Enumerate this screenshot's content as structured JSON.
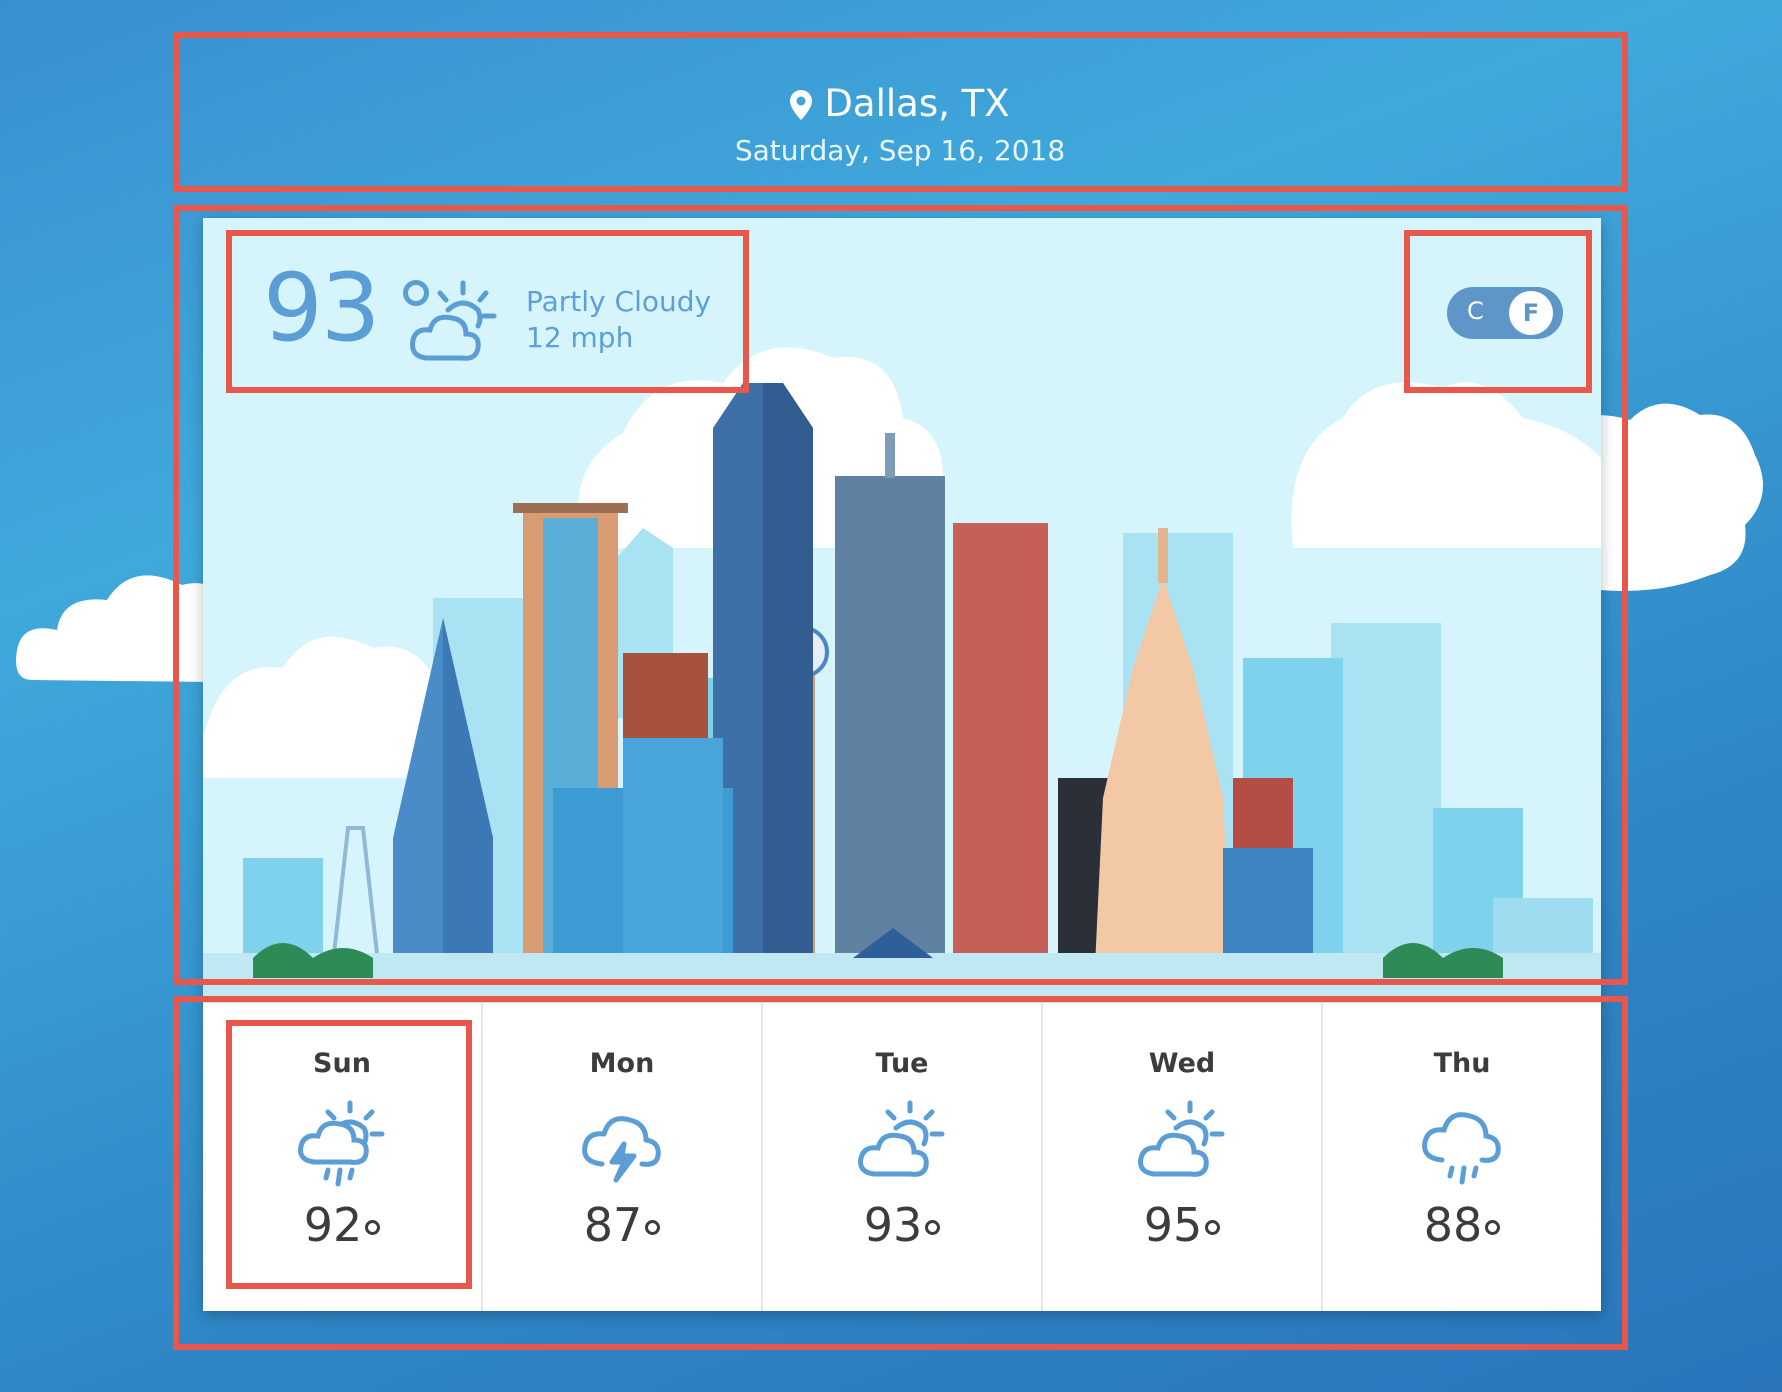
{
  "location": {
    "city": "Dallas, TX",
    "date": "Saturday, Sep 16, 2018"
  },
  "current": {
    "temperature": "93",
    "condition": "Partly Cloudy",
    "wind": "12 mph",
    "icon": "partly-cloudy-icon"
  },
  "units": {
    "celsius_label": "C",
    "fahrenheit_label": "F",
    "selected": "F"
  },
  "forecast": [
    {
      "day": "Sun",
      "temp": "92",
      "icon": "sun-cloud-rain-icon"
    },
    {
      "day": "Mon",
      "temp": "87",
      "icon": "thunderstorm-icon"
    },
    {
      "day": "Tue",
      "temp": "93",
      "icon": "partly-cloudy-icon"
    },
    {
      "day": "Wed",
      "temp": "95",
      "icon": "partly-cloudy-icon"
    },
    {
      "day": "Thu",
      "temp": "88",
      "icon": "rain-icon"
    }
  ],
  "colors": {
    "accent": "#5b9ed6",
    "annotation": "#e8574b",
    "sky": "#d6f4fb"
  }
}
